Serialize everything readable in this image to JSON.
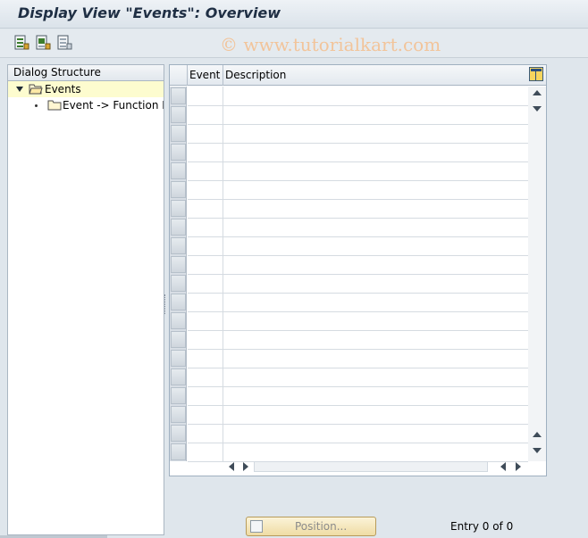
{
  "window": {
    "title": "Display View \"Events\": Overview"
  },
  "toolbar": {
    "buttons": [
      {
        "name": "select-all-icon"
      },
      {
        "name": "select-block-icon"
      },
      {
        "name": "deselect-all-icon"
      }
    ]
  },
  "watermark": "© www.tutorialkart.com",
  "dialog_structure": {
    "header": "Dialog Structure",
    "items": [
      {
        "label": "Events",
        "level": 0,
        "expanded": true,
        "selected": true,
        "icon": "folder-open-icon"
      },
      {
        "label": "Event -> Function M",
        "level": 1,
        "expanded": false,
        "selected": false,
        "icon": "folder-icon"
      }
    ]
  },
  "table": {
    "columns": [
      "Event",
      "Description"
    ],
    "row_count": 20,
    "rows": []
  },
  "footer": {
    "position_button": "Position...",
    "entry_text": "Entry 0 of 0"
  },
  "colors": {
    "selected_row": "#fdfccf",
    "background": "#dfe6ec",
    "button_fill": "#efdca4",
    "watermark": "#f2c49a"
  }
}
